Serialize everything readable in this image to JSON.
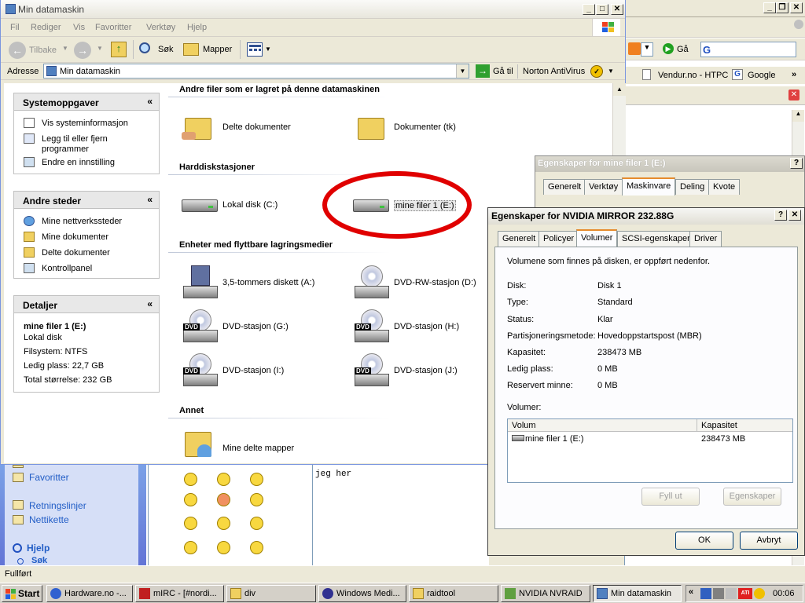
{
  "background_window": {
    "go_label": "Gå",
    "links": [
      "Vendur.no - HTPC",
      "Google"
    ]
  },
  "bottom_window": {
    "links": [
      "Favoritter",
      "Retningslinjer",
      "Nettikette",
      "Hjelp",
      "Søk"
    ],
    "chat_text": [
      "jeg her"
    ]
  },
  "explorer": {
    "title": "Min datamaskin",
    "menu": [
      "Fil",
      "Rediger",
      "Vis",
      "Favoritter",
      "Verktøy",
      "Hjelp"
    ],
    "toolbar": {
      "back": "Tilbake",
      "search": "Søk",
      "folders": "Mapper"
    },
    "address_label": "Adresse",
    "address_value": "Min datamaskin",
    "go_label": "Gå til",
    "antivirus": "Norton AntiVirus",
    "system_tasks": {
      "title": "Systemoppgaver",
      "items": [
        "Vis systeminformasjon",
        "Legg til eller fjern programmer",
        "Endre en innstilling"
      ]
    },
    "other_places": {
      "title": "Andre steder",
      "items": [
        "Mine nettverkssteder",
        "Mine dokumenter",
        "Delte dokumenter",
        "Kontrollpanel"
      ]
    },
    "details": {
      "title": "Detaljer",
      "name": "mine filer 1 (E:)",
      "type": "Lokal disk",
      "filesystem": "Filsystem: NTFS",
      "free": "Ledig plass: 22,7 GB",
      "total": "Total størrelse: 232 GB"
    },
    "sections": {
      "files": "Andre filer som er lagret på denne datamaskinen",
      "hdd": "Harddiskstasjoner",
      "removable": "Enheter med flyttbare lagringsmedier",
      "other": "Annet"
    },
    "files": [
      "Delte dokumenter",
      "Dokumenter (tk)"
    ],
    "drives": [
      "Lokal disk (C:)",
      "mine filer 1 (E:)"
    ],
    "removable": [
      "3,5-tommers diskett (A:)",
      "DVD-RW-stasjon (D:)",
      "DVD-stasjon (G:)",
      "DVD-stasjon (H:)",
      "DVD-stasjon (I:)",
      "DVD-stasjon (J:)"
    ],
    "other": [
      "Mine delte mapper"
    ],
    "dvd_badge": "DVD"
  },
  "props_behind": {
    "title": "Egenskaper for mine filer 1 (E:)",
    "tabs": [
      "Generelt",
      "Verktøy",
      "Maskinvare",
      "Deling",
      "Kvote"
    ],
    "active_tab": "Maskinvare"
  },
  "props_front": {
    "title": "Egenskaper for NVIDIA  MIRROR  232.88G",
    "tabs": [
      "Generelt",
      "Policyer",
      "Volumer",
      "SCSI-egenskaper",
      "Driver"
    ],
    "active_tab": "Volumer",
    "intro": "Volumene som finnes på disken, er oppført nedenfor.",
    "fields": [
      {
        "label": "Disk:",
        "value": "Disk 1"
      },
      {
        "label": "Type:",
        "value": "Standard"
      },
      {
        "label": "Status:",
        "value": "Klar"
      },
      {
        "label": "Partisjoneringsmetode:",
        "value": "Hovedoppstartspost (MBR)"
      },
      {
        "label": "Kapasitet:",
        "value": "238473 MB"
      },
      {
        "label": "Ledig plass:",
        "value": "0 MB"
      },
      {
        "label": "Reservert minne:",
        "value": "0 MB"
      }
    ],
    "volumes_label": "Volumer:",
    "col_volume": "Volum",
    "col_capacity": "Kapasitet",
    "volume_rows": [
      {
        "name": "mine filer 1 (E:)",
        "capacity": "238473 MB"
      }
    ],
    "populate_button": "Fyll ut",
    "properties_button": "Egenskaper",
    "ok_button": "OK",
    "cancel_button": "Avbryt"
  },
  "status_text": "Fullført",
  "taskbar": {
    "start": "Start",
    "tasks": [
      "Hardware.no -...",
      "mIRC - [#nordi...",
      "div",
      "Windows Medi...",
      "raidtool",
      "NVIDIA NVRAID",
      "Min datamaskin"
    ],
    "active_task": "Min datamaskin",
    "clock": "00:06"
  },
  "colors": {
    "highlight_circle": "#e00000",
    "taskbar": "#d4d0c8",
    "link": "#215dc6"
  }
}
